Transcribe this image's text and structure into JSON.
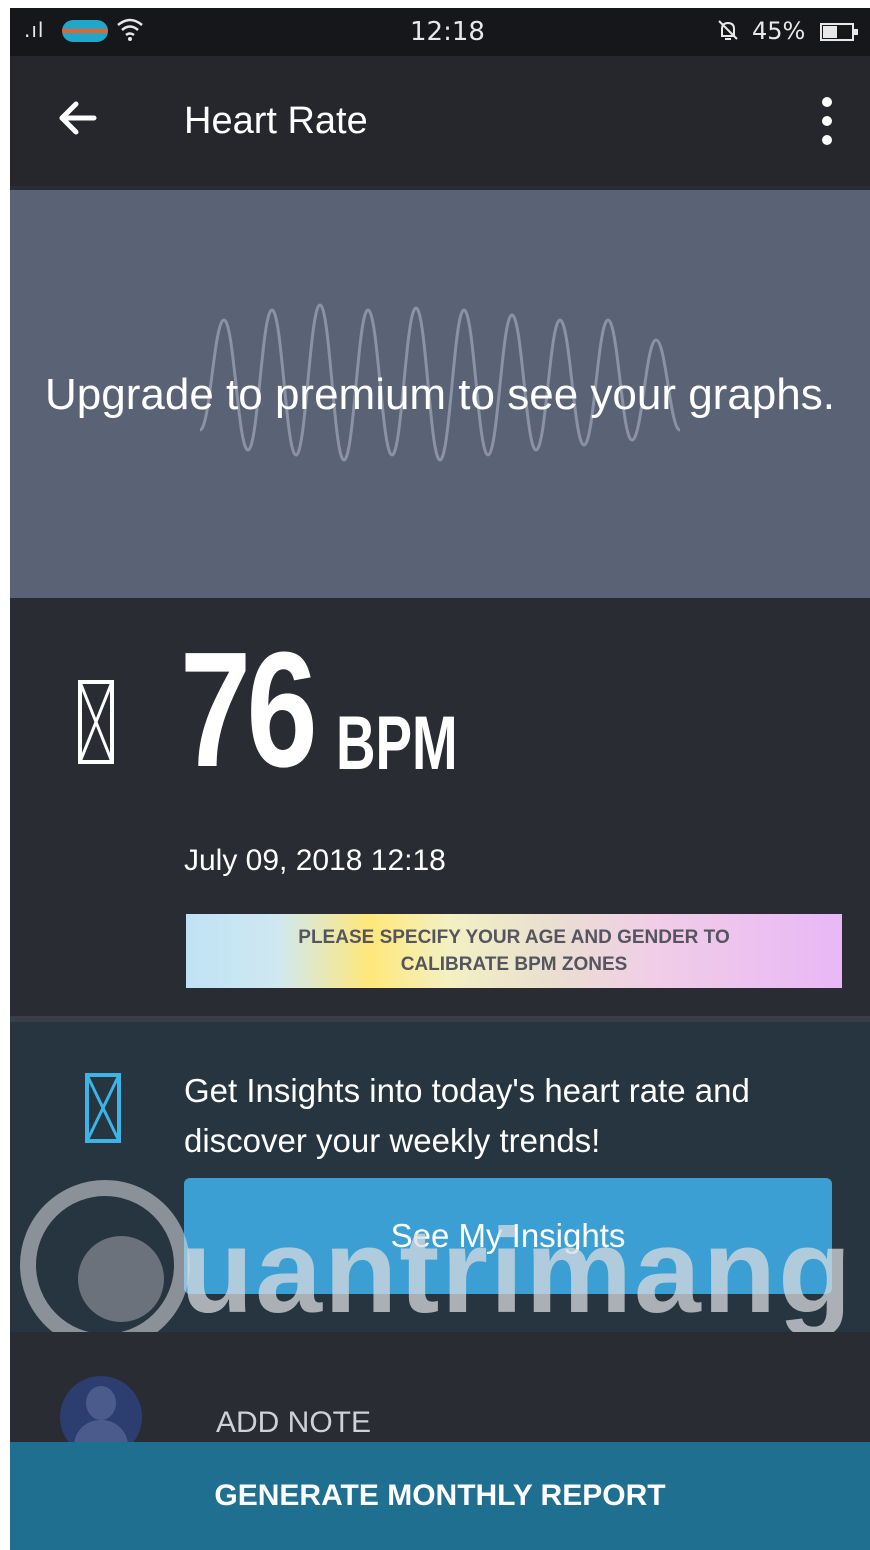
{
  "status_bar": {
    "signal": ".ıl",
    "time": "12:18",
    "battery": "45%"
  },
  "header": {
    "title": "Heart Rate"
  },
  "graph": {
    "message": "Upgrade to premium to see your graphs."
  },
  "reading": {
    "value": "76",
    "unit": "BPM",
    "timestamp": "July 09, 2018 12:18",
    "calibrate_line1": "PLEASE SPECIFY YOUR AGE AND GENDER TO",
    "calibrate_line2": "CALIBRATE BPM ZONES"
  },
  "insights": {
    "text": "Get Insights into today's heart rate and discover your weekly trends!",
    "button_label": "See My Insights"
  },
  "note": {
    "label": "ADD NOTE"
  },
  "footer": {
    "report_label": "GENERATE MONTHLY REPORT"
  },
  "watermark": {
    "text": "uantrimang"
  },
  "colors": {
    "background": "#2a2c33",
    "graph_panel": "#5a6275",
    "insights_panel": "#263540",
    "insights_button": "#3c9fd4",
    "report_bar": "#1f6f91"
  },
  "icons": {
    "back": "arrow-left-icon",
    "more": "more-vertical-icon",
    "heart": "heart-outline-icon",
    "insights": "insights-icon",
    "avatar": "user-avatar-icon"
  }
}
